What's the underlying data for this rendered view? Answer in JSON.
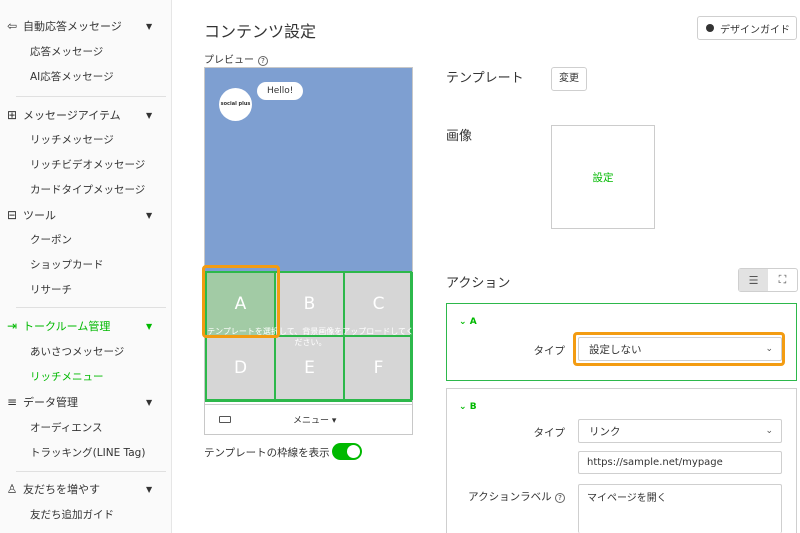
{
  "sidebar": {
    "groups": [
      {
        "icon": "auto-reply-icon",
        "glyph": "⇦",
        "label": "自動応答メッセージ",
        "items": [
          "応答メッセージ",
          "AI応答メッセージ"
        ]
      },
      {
        "icon": "message-item-icon",
        "glyph": "⊞",
        "label": "メッセージアイテム",
        "items": [
          "リッチメッセージ",
          "リッチビデオメッセージ",
          "カードタイプメッセージ"
        ]
      },
      {
        "icon": "tool-icon",
        "glyph": "⊟",
        "label": "ツール",
        "items": [
          "クーポン",
          "ショップカード",
          "リサーチ"
        ]
      },
      {
        "icon": "talk-room-icon",
        "glyph": "⇥",
        "label": "トークルーム管理",
        "items": [
          "あいさつメッセージ",
          "リッチメニュー"
        ]
      },
      {
        "icon": "database-icon",
        "glyph": "≡",
        "label": "データ管理",
        "items": [
          "オーディエンス",
          "トラッキング(LINE Tag)"
        ]
      },
      {
        "icon": "add-friends-icon",
        "glyph": "♙",
        "label": "友だちを増やす",
        "items": [
          "友だち追加ガイド"
        ]
      }
    ]
  },
  "page": {
    "title": "コンテンツ設定",
    "design_guide": "デザインガイド"
  },
  "preview": {
    "label": "プレビュー",
    "bot_name": "social plus",
    "bubble": "Hello!",
    "cells": [
      "A",
      "B",
      "C",
      "D",
      "E",
      "F"
    ],
    "overlay_line1": "テンプレートを選択して、背景画像をアップロードしてく",
    "overlay_line2": "ださい。",
    "menu_text": "メニュー ▾",
    "toggle_label": "テンプレートの枠線を表示",
    "toggle_on": true
  },
  "settings": {
    "template_label": "テンプレート",
    "change_label": "変更",
    "image_label": "画像",
    "image_set": "設定",
    "action_label": "アクション"
  },
  "actions": [
    {
      "id": "A",
      "type_label": "タイプ",
      "type_value": "設定しない"
    },
    {
      "id": "B",
      "type_label": "タイプ",
      "type_value": "リンク",
      "url": "https://sample.net/mypage",
      "action_label_title": "アクションラベル",
      "action_label_value": "マイページを開く"
    }
  ],
  "colors": {
    "accent": "#00b900",
    "highlight": "#f39c12",
    "preview_bg": "#7e9fd1"
  }
}
